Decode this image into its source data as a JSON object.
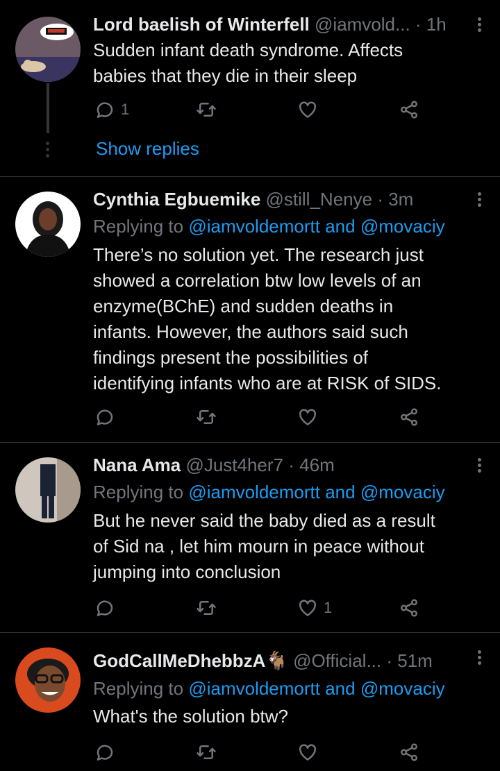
{
  "tweets": [
    {
      "name": "Lord baelish of Winterfell",
      "handle": "@iamvold...",
      "separator": "·",
      "time": "1h",
      "text_lines": [
        "Sudden infant death syndrome. Affects",
        "babies that they die in their sleep"
      ],
      "reply_count": "1",
      "like_count": "",
      "show_replies": "Show replies"
    },
    {
      "name": "Cynthia Egbuemike",
      "handle": "@still_Nenye",
      "separator": "·",
      "time": "3m",
      "replying_prefix": "Replying to",
      "mention1": "@iamvoldemortt",
      "conj": "and",
      "mention2": "@movaciy",
      "text_lines": [
        "There’s no solution yet. The research just",
        "showed a correlation btw low levels of an",
        "enzyme(BChE) and sudden deaths in",
        "infants. However, the authors said such",
        "findings present the possibilities of",
        "identifying infants who are at RISK of SIDS."
      ],
      "reply_count": "",
      "like_count": ""
    },
    {
      "name": "Nana Ama",
      "handle": "@Just4her7",
      "separator": "·",
      "time": "46m",
      "replying_prefix": "Replying to",
      "mention1": "@iamvoldemortt",
      "conj": "and",
      "mention2": "@movaciy",
      "text_lines": [
        "But he never said the baby died as a result",
        "of Sid na , let him mourn in peace without",
        "jumping into conclusion"
      ],
      "reply_count": "",
      "like_count": "1"
    },
    {
      "name": "GodCallMeDhebbzA",
      "name_emoji": "🐐",
      "handle": "@Official...",
      "separator": "·",
      "time": "51m",
      "replying_prefix": "Replying to",
      "mention1": "@iamvoldemortt",
      "conj": "and",
      "mention2": "@movaciy",
      "text_lines": [
        "What's the solution btw?"
      ],
      "reply_count": "",
      "like_count": ""
    }
  ],
  "colors": {
    "background": "#000000",
    "text": "#e7e9ea",
    "muted": "#71767b",
    "accent": "#1d9bf0"
  },
  "icons": [
    "reply-icon",
    "retweet-icon",
    "like-icon",
    "share-icon",
    "more-icon"
  ]
}
